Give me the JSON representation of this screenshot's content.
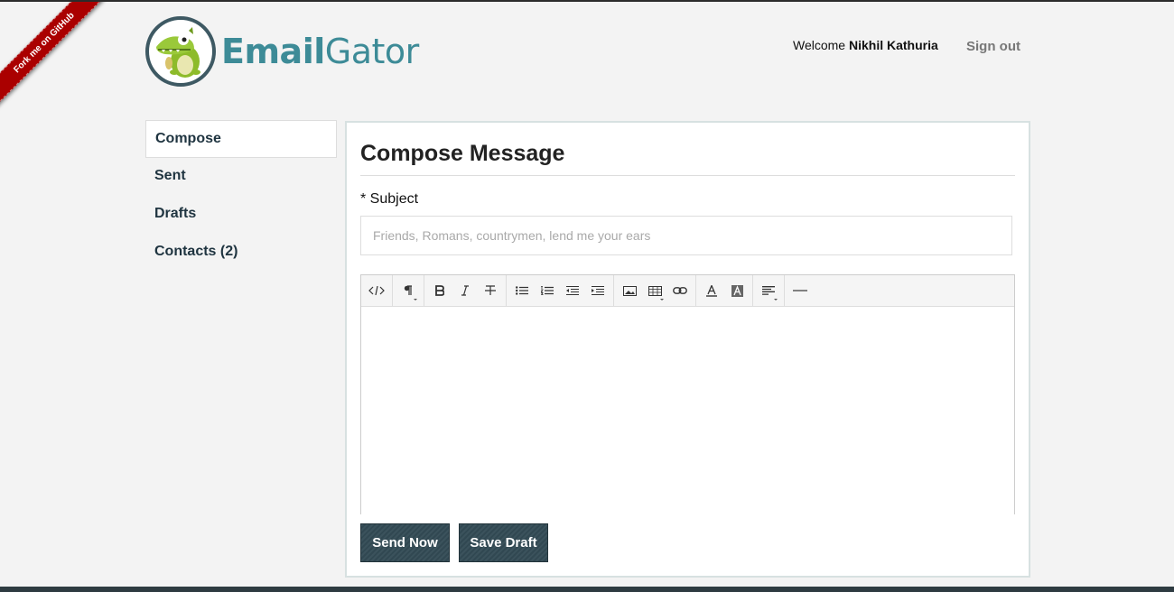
{
  "ribbon": {
    "label": "Fork me on GitHub"
  },
  "header": {
    "logo_text_bold": "Email",
    "logo_text_light": "Gator",
    "welcome_prefix": "Welcome",
    "user_name": "Nikhil Kathuria",
    "signout_label": "Sign out"
  },
  "sidebar": {
    "items": [
      {
        "label": "Compose"
      },
      {
        "label": "Sent"
      },
      {
        "label": "Drafts"
      },
      {
        "label": "Contacts (2)"
      }
    ]
  },
  "main": {
    "title": "Compose Message",
    "subject_label": "* Subject",
    "subject_placeholder": "Friends, Romans, countrymen, lend me your ears",
    "subject_value": "",
    "toolbar_icons": [
      "code-view-icon",
      "paragraph-style-icon",
      "bold-icon",
      "italic-icon",
      "strikethrough-icon",
      "unordered-list-icon",
      "ordered-list-icon",
      "outdent-icon",
      "indent-icon",
      "image-icon",
      "table-icon",
      "link-icon",
      "font-color-icon",
      "background-color-icon",
      "align-icon",
      "horizontal-rule-icon"
    ],
    "send_label": "Send Now",
    "draft_label": "Save Draft"
  },
  "colors": {
    "accent": "#3d8b97",
    "button": "#334b55",
    "ribbon": "#aa0000"
  }
}
